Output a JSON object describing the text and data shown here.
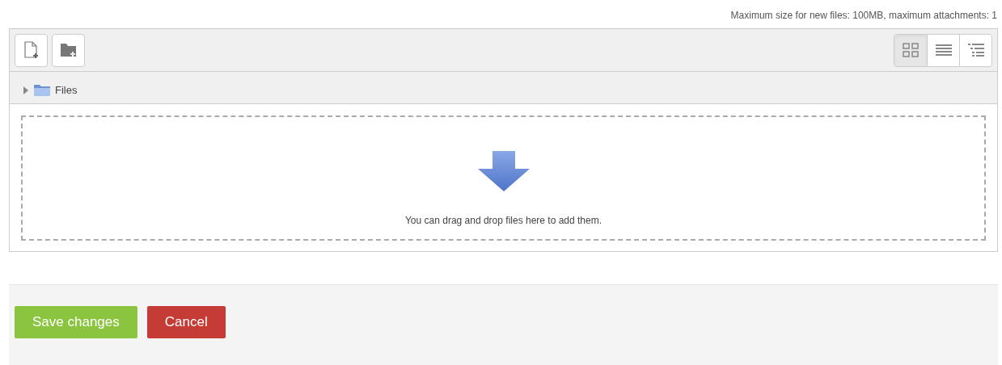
{
  "limits_note": "Maximum size for new files: 100MB, maximum attachments: 1",
  "toolbar": {
    "actions": [
      {
        "kind": "add-file"
      },
      {
        "kind": "create-folder"
      }
    ],
    "view_modes": [
      {
        "kind": "icons",
        "selected": true
      },
      {
        "kind": "list",
        "selected": false
      },
      {
        "kind": "tree",
        "selected": false
      }
    ]
  },
  "path": {
    "label": "Files",
    "expanded": false
  },
  "dropzone": {
    "message": "You can drag and drop files here to add them."
  },
  "buttons": [
    {
      "label": "Save changes",
      "kind": "primary"
    },
    {
      "label": "Cancel",
      "kind": "danger"
    }
  ]
}
